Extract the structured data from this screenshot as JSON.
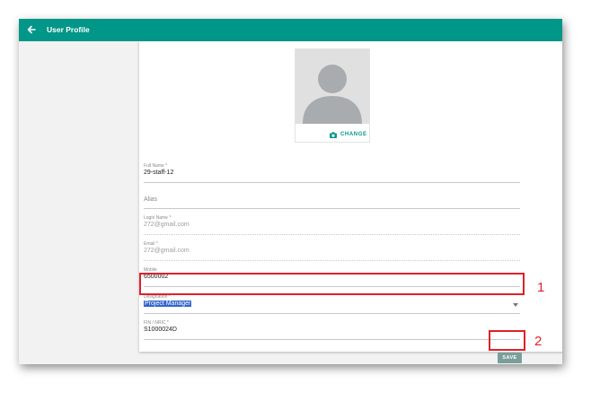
{
  "header": {
    "title": "User Profile",
    "back_icon": "arrow-left-icon"
  },
  "avatar": {
    "change_label": "CHANGE",
    "camera_icon": "camera-icon"
  },
  "fields": {
    "full_name": {
      "label": "Full Name *",
      "value": "29-staff-12"
    },
    "alias": {
      "placeholder": "Alias"
    },
    "login_name": {
      "label": "Login Name *",
      "value": "272@gmail.com"
    },
    "email": {
      "label": "Email *",
      "value": "272@gmail.com"
    },
    "mobile": {
      "label": "Mobile",
      "value": "6500002"
    },
    "designation": {
      "label": "Designation *",
      "value": "Project Manager"
    },
    "fin_nric": {
      "label": "FIN / NRIC *",
      "value": "S1000024D"
    }
  },
  "actions": {
    "save_label": "SAVE"
  },
  "annotations": {
    "callout_1": "1",
    "callout_2": "2",
    "color": "#e0202a"
  },
  "colors": {
    "appbar": "#009688",
    "save_button": "#7a9f9a",
    "selection": "#3366cc"
  }
}
